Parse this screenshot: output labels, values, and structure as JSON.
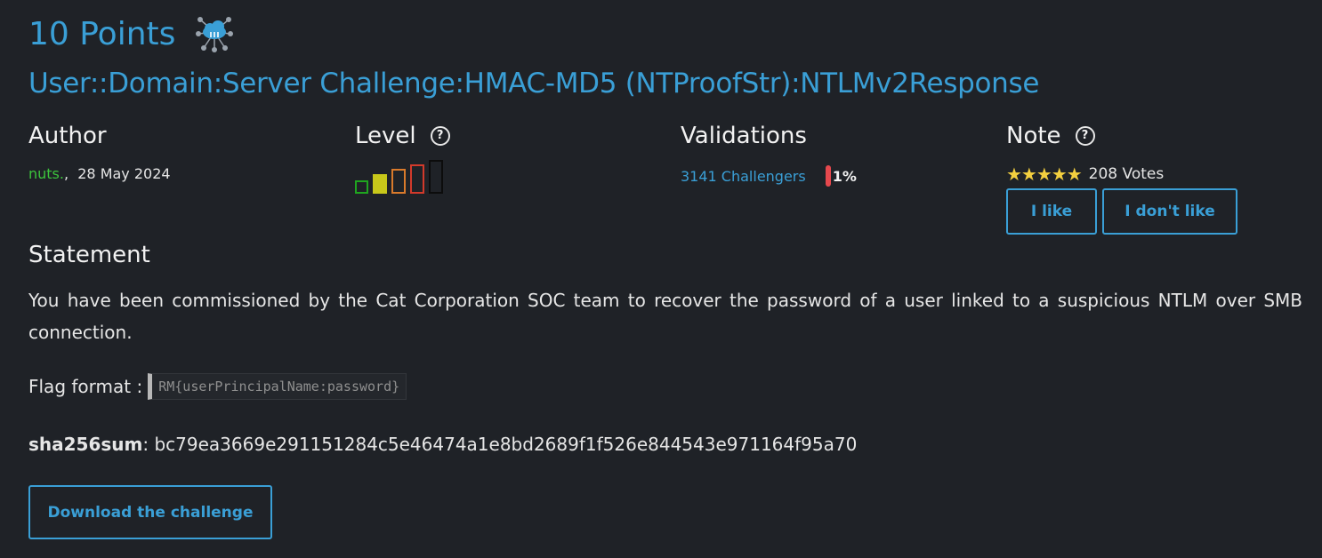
{
  "header": {
    "points": "10 Points",
    "icon": "network-cloud-icon",
    "title": "User::Domain:Server Challenge:HMAC-MD5 (NTProofStr):NTLMv2Response"
  },
  "author": {
    "heading": "Author",
    "name": "nuts.",
    "separator": ",",
    "date": "28 May 2024"
  },
  "level": {
    "heading": "Level",
    "help_icon": "question-circle-icon",
    "current_level": 2,
    "max_level": 5,
    "colors": [
      "#1fa51f",
      "#c8c81a",
      "#d97a2b",
      "#d23a2b",
      "#111111"
    ]
  },
  "validations": {
    "heading": "Validations",
    "challengers": "3141 Challengers",
    "percent": "1%",
    "bar_color": "#e5484d"
  },
  "note": {
    "heading": "Note",
    "help_icon": "question-circle-icon",
    "stars": "★★★★★",
    "votes": "208 Votes",
    "like_label": "I like",
    "dislike_label": "I don't like"
  },
  "statement": {
    "heading": "Statement",
    "text": "You have been commissioned by the Cat Corporation SOC team to recover the password of a user linked to a suspicious NTLM over SMB connection.",
    "flag_label": "Flag format :",
    "flag_format": "RM{userPrincipalName:password}",
    "sha_label": "sha256sum",
    "sha_value": ": bc79ea3669e291151284c5e46474a1e8bd2689f1f526e844543e971164f95a70"
  },
  "download_label": "Download the challenge",
  "colors": {
    "accent": "#3a9fd6",
    "background": "#1f2227",
    "author": "#3cc43c"
  }
}
